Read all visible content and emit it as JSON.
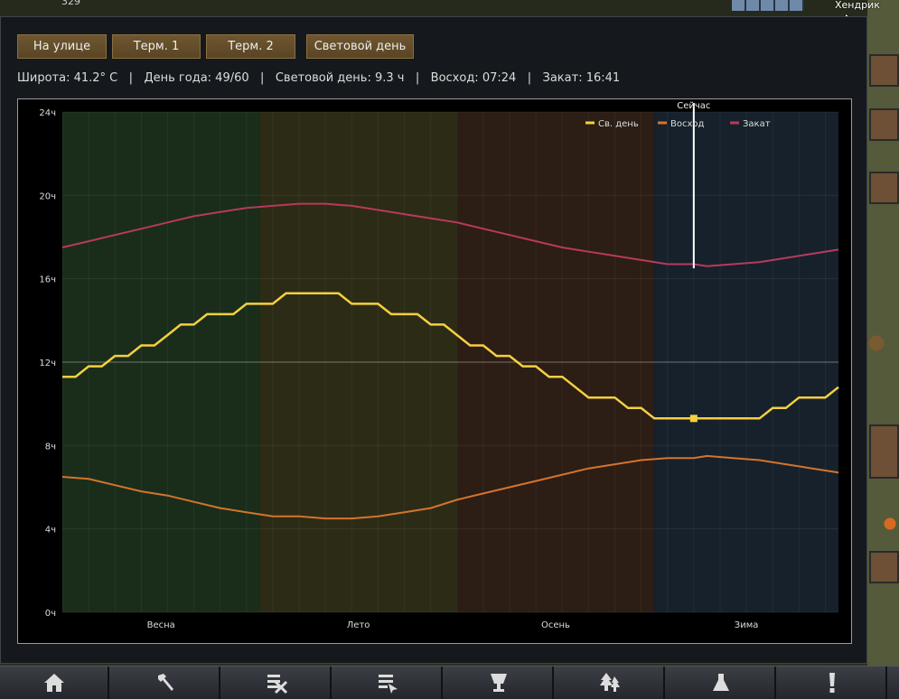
{
  "hud": {
    "top_number": "329",
    "pawn_name": "Хендрик"
  },
  "tabs": [
    {
      "label": "На улице"
    },
    {
      "label": "Терм. 1"
    },
    {
      "label": "Терм. 2"
    },
    {
      "label": "Световой день"
    }
  ],
  "info": {
    "latitude": "Широта: 41.2° C",
    "day_of_year": "День года: 49/60",
    "daylight": "Световой день: 9.3 ч",
    "sunrise": "Восход: 07:24",
    "sunset": "Закат: 16:41",
    "separator": "|"
  },
  "chart_data": {
    "type": "line",
    "title": "",
    "xlabel": "",
    "ylabel": "",
    "ylim": [
      0,
      24
    ],
    "xlim": [
      1,
      60
    ],
    "y_ticks": [
      "0ч",
      "4ч",
      "8ч",
      "12ч",
      "16ч",
      "20ч",
      "24ч"
    ],
    "seasons": [
      {
        "name": "Весна",
        "start": 1,
        "end": 16,
        "color": "#1a2d1a"
      },
      {
        "name": "Лето",
        "start": 16,
        "end": 31,
        "color": "#2c2b16"
      },
      {
        "name": "Осень",
        "start": 31,
        "end": 46,
        "color": "#2c1d15"
      },
      {
        "name": "Зима",
        "start": 46,
        "end": 60,
        "color": "#16212c"
      }
    ],
    "now": {
      "label": "Сейчас",
      "day": 49
    },
    "legend_position": "top-right",
    "grid": true,
    "series": [
      {
        "name": "Св. день",
        "color": "#f5d040",
        "points": [
          [
            1,
            11.3
          ],
          [
            2,
            11.3
          ],
          [
            3,
            11.8
          ],
          [
            4,
            11.8
          ],
          [
            5,
            12.3
          ],
          [
            6,
            12.3
          ],
          [
            7,
            12.8
          ],
          [
            8,
            12.8
          ],
          [
            9,
            13.3
          ],
          [
            10,
            13.8
          ],
          [
            11,
            13.8
          ],
          [
            12,
            14.3
          ],
          [
            13,
            14.3
          ],
          [
            14,
            14.3
          ],
          [
            15,
            14.8
          ],
          [
            16,
            14.8
          ],
          [
            17,
            14.8
          ],
          [
            18,
            15.3
          ],
          [
            19,
            15.3
          ],
          [
            20,
            15.3
          ],
          [
            21,
            15.3
          ],
          [
            22,
            15.3
          ],
          [
            23,
            14.8
          ],
          [
            24,
            14.8
          ],
          [
            25,
            14.8
          ],
          [
            26,
            14.3
          ],
          [
            27,
            14.3
          ],
          [
            28,
            14.3
          ],
          [
            29,
            13.8
          ],
          [
            30,
            13.8
          ],
          [
            31,
            13.3
          ],
          [
            32,
            12.8
          ],
          [
            33,
            12.8
          ],
          [
            34,
            12.3
          ],
          [
            35,
            12.3
          ],
          [
            36,
            11.8
          ],
          [
            37,
            11.8
          ],
          [
            38,
            11.3
          ],
          [
            39,
            11.3
          ],
          [
            40,
            10.8
          ],
          [
            41,
            10.3
          ],
          [
            42,
            10.3
          ],
          [
            43,
            10.3
          ],
          [
            44,
            9.8
          ],
          [
            45,
            9.8
          ],
          [
            46,
            9.3
          ],
          [
            47,
            9.3
          ],
          [
            48,
            9.3
          ],
          [
            49,
            9.3
          ],
          [
            50,
            9.3
          ],
          [
            51,
            9.3
          ],
          [
            52,
            9.3
          ],
          [
            53,
            9.3
          ],
          [
            54,
            9.3
          ],
          [
            55,
            9.8
          ],
          [
            56,
            9.8
          ],
          [
            57,
            10.3
          ],
          [
            58,
            10.3
          ],
          [
            59,
            10.3
          ],
          [
            60,
            10.8
          ]
        ]
      },
      {
        "name": "Восход",
        "color": "#d4742c",
        "points": [
          [
            1,
            6.5
          ],
          [
            3,
            6.4
          ],
          [
            5,
            6.1
          ],
          [
            7,
            5.8
          ],
          [
            9,
            5.6
          ],
          [
            11,
            5.3
          ],
          [
            13,
            5.0
          ],
          [
            15,
            4.8
          ],
          [
            17,
            4.6
          ],
          [
            19,
            4.6
          ],
          [
            21,
            4.5
          ],
          [
            23,
            4.5
          ],
          [
            25,
            4.6
          ],
          [
            27,
            4.8
          ],
          [
            29,
            5.0
          ],
          [
            31,
            5.4
          ],
          [
            33,
            5.7
          ],
          [
            35,
            6.0
          ],
          [
            37,
            6.3
          ],
          [
            39,
            6.6
          ],
          [
            41,
            6.9
          ],
          [
            43,
            7.1
          ],
          [
            45,
            7.3
          ],
          [
            47,
            7.4
          ],
          [
            49,
            7.4
          ],
          [
            50,
            7.5
          ],
          [
            52,
            7.4
          ],
          [
            54,
            7.3
          ],
          [
            56,
            7.1
          ],
          [
            58,
            6.9
          ],
          [
            60,
            6.7
          ]
        ]
      },
      {
        "name": "Закат",
        "color": "#b83a5a",
        "points": [
          [
            1,
            17.5
          ],
          [
            3,
            17.8
          ],
          [
            5,
            18.1
          ],
          [
            7,
            18.4
          ],
          [
            9,
            18.7
          ],
          [
            11,
            19.0
          ],
          [
            13,
            19.2
          ],
          [
            15,
            19.4
          ],
          [
            17,
            19.5
          ],
          [
            19,
            19.6
          ],
          [
            21,
            19.6
          ],
          [
            23,
            19.5
          ],
          [
            25,
            19.3
          ],
          [
            27,
            19.1
          ],
          [
            29,
            18.9
          ],
          [
            31,
            18.7
          ],
          [
            33,
            18.4
          ],
          [
            35,
            18.1
          ],
          [
            37,
            17.8
          ],
          [
            39,
            17.5
          ],
          [
            41,
            17.3
          ],
          [
            43,
            17.1
          ],
          [
            45,
            16.9
          ],
          [
            47,
            16.7
          ],
          [
            49,
            16.7
          ],
          [
            50,
            16.6
          ],
          [
            52,
            16.7
          ],
          [
            54,
            16.8
          ],
          [
            56,
            17.0
          ],
          [
            58,
            17.2
          ],
          [
            60,
            17.4
          ]
        ]
      }
    ]
  },
  "bottom_bar": [
    {
      "icon": "home-icon"
    },
    {
      "icon": "hammer-icon"
    },
    {
      "icon": "cancel-orders-icon"
    },
    {
      "icon": "orders-icon"
    },
    {
      "icon": "cup-icon"
    },
    {
      "icon": "tree-icon"
    },
    {
      "icon": "flask-icon"
    },
    {
      "icon": "alert-icon"
    }
  ]
}
